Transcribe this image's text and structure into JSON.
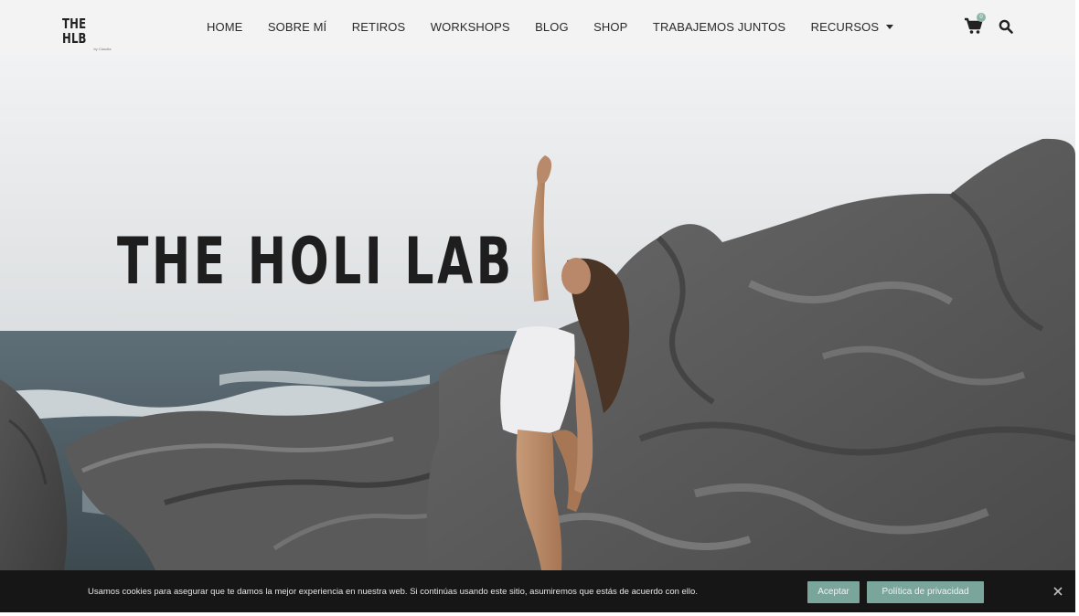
{
  "header": {
    "logo_text": "THE HLB",
    "logo_subtext": "by Claudia",
    "nav": [
      {
        "label": "HOME"
      },
      {
        "label": "SOBRE MÍ"
      },
      {
        "label": "RETIROS"
      },
      {
        "label": "WORKSHOPS"
      },
      {
        "label": "BLOG"
      },
      {
        "label": "SHOP"
      },
      {
        "label": "TRABAJEMOS JUNTOS"
      },
      {
        "label": "RECURSOS"
      }
    ],
    "cart_count": "0",
    "icons": [
      "shopping-cart-icon",
      "search-icon",
      "chevron-down-icon"
    ]
  },
  "hero": {
    "title": "THE HOLI LAB",
    "image": "woman in white swimsuit doing standing yoga pose on grey coastal rocks by the sea"
  },
  "cookie": {
    "text": "Usamos cookies para asegurar que te damos la mejor experiencia en nuestra web. Si continúas usando este sitio, asumiremos que estás de acuerdo con ello.",
    "accept_label": "Aceptar",
    "privacy_label": "Política de privacidad"
  },
  "colors": {
    "accent": "#7aa59a",
    "header_bg": "#f3f3f4",
    "cookie_bg": "#161616"
  }
}
